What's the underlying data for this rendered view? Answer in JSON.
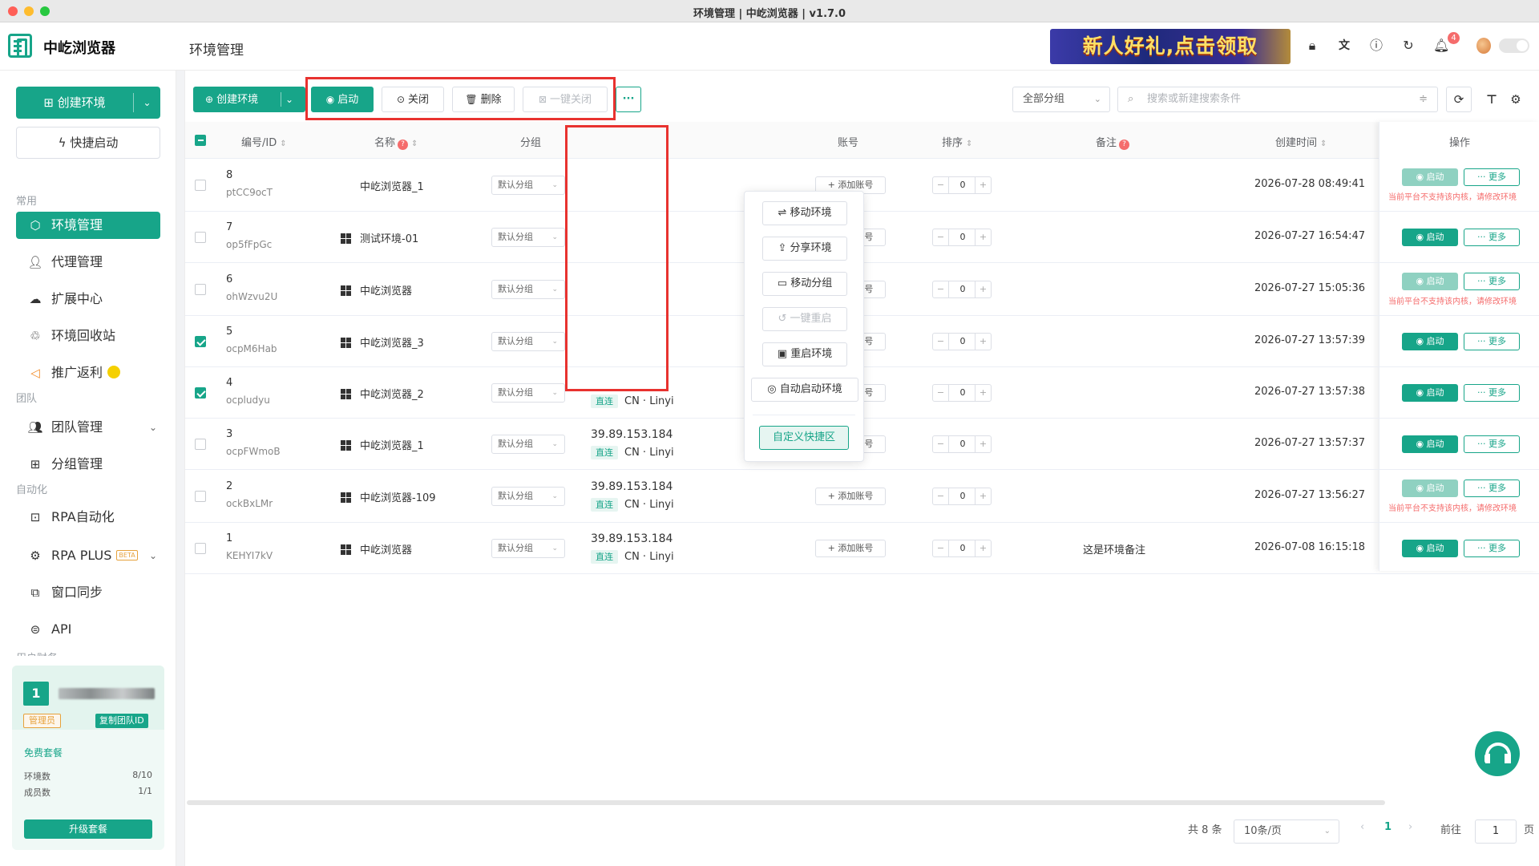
{
  "window": {
    "title": "环境管理 | 中屹浏览器 | v1.7.0"
  },
  "header": {
    "brand": "中屹浏览器",
    "page_title": "环境管理",
    "promo_text": "新人好礼,点击领取",
    "notification_count": "4"
  },
  "sidebar": {
    "create_env": "创建环境",
    "quick_start": "快捷启动",
    "section_common": "常用",
    "env_manage": "环境管理",
    "proxy_manage": "代理管理",
    "extension_center": "扩展中心",
    "env_recycle": "环境回收站",
    "promo_rebate": "推广返利",
    "section_team": "团队",
    "team_manage": "团队管理",
    "group_manage": "分组管理",
    "section_automation": "自动化",
    "rpa": "RPA自动化",
    "rpa_plus": "RPA PLUS",
    "beta": "BETA",
    "window_sync": "窗口同步",
    "api": "API",
    "section_user": "用户财务"
  },
  "team_card": {
    "number": "1",
    "role": "管理员",
    "copy_id": "复制团队ID",
    "plan": "免费套餐",
    "env_count_label": "环境数",
    "env_count_value": "8/10",
    "member_count_label": "成员数",
    "member_count_value": "1/1",
    "upgrade": "升级套餐"
  },
  "toolbar": {
    "create_env": "创建环境",
    "start": "启动",
    "close": "关闭",
    "delete": "删除",
    "close_all": "一键关闭",
    "more": "···",
    "group_filter": "全部分组",
    "search_placeholder": "搜索或新建搜索条件"
  },
  "table": {
    "headers": {
      "id": "编号/ID",
      "name": "名称",
      "group": "分组",
      "account": "账号",
      "sort": "排序",
      "note": "备注",
      "created": "创建时间",
      "ops": "操作"
    },
    "add_account": "添加账号",
    "start_label": "启动",
    "more_label": "更多",
    "warn_text": "当前平台不支持该内核，请修改环境",
    "direct_label": "直连",
    "rows": [
      {
        "id": "8",
        "code": "ptCC9ocT",
        "name": "中屹浏览器_1",
        "os": "mac",
        "group": "默认分组",
        "ip": "",
        "loc": "",
        "sort": "0",
        "note": "",
        "created": "2026-07-28 08:49:41",
        "checked": false,
        "disabled": true
      },
      {
        "id": "7",
        "code": "op5fFpGc",
        "name": "测试环境-01",
        "os": "win",
        "group": "默认分组",
        "ip": "",
        "loc": "",
        "sort": "0",
        "note": "",
        "created": "2026-07-27 16:54:47",
        "checked": false,
        "disabled": false
      },
      {
        "id": "6",
        "code": "ohWzvu2U",
        "name": "中屹浏览器",
        "os": "win",
        "group": "默认分组",
        "ip": "",
        "loc": "",
        "sort": "0",
        "note": "",
        "created": "2026-07-27 15:05:36",
        "checked": false,
        "disabled": true
      },
      {
        "id": "5",
        "code": "ocpM6Hab",
        "name": "中屹浏览器_3",
        "os": "win",
        "group": "默认分组",
        "ip": "",
        "loc": "",
        "sort": "0",
        "note": "",
        "created": "2026-07-27 13:57:39",
        "checked": true,
        "disabled": false
      },
      {
        "id": "4",
        "code": "ocpludyu",
        "name": "中屹浏览器_2",
        "os": "win",
        "group": "默认分组",
        "ip": "",
        "loc": "CN · Linyi",
        "sort": "0",
        "note": "",
        "created": "2026-07-27 13:57:38",
        "checked": true,
        "disabled": false
      },
      {
        "id": "3",
        "code": "ocpFWmoB",
        "name": "中屹浏览器_1",
        "os": "win",
        "group": "默认分组",
        "ip": "39.89.153.184",
        "loc": "CN · Linyi",
        "sort": "0",
        "note": "",
        "created": "2026-07-27 13:57:37",
        "checked": false,
        "disabled": false
      },
      {
        "id": "2",
        "code": "ockBxLMr",
        "name": "中屹浏览器-109",
        "os": "win",
        "group": "默认分组",
        "ip": "39.89.153.184",
        "loc": "CN · Linyi",
        "sort": "0",
        "note": "",
        "created": "2026-07-27 13:56:27",
        "checked": false,
        "disabled": true
      },
      {
        "id": "1",
        "code": "KEHYI7kV",
        "name": "中屹浏览器",
        "os": "win",
        "group": "默认分组",
        "ip": "39.89.153.184",
        "loc": "CN · Linyi",
        "sort": "0",
        "note": "这是环境备注",
        "created": "2026-07-08 16:15:18",
        "checked": false,
        "disabled": false
      }
    ]
  },
  "dropdown": {
    "move_env": "移动环境",
    "share_env": "分享环境",
    "move_group": "移动分组",
    "one_click_restart": "一键重启",
    "restart_env": "重启环境",
    "auto_start_env": "自动启动环境",
    "custom_shortcut": "自定义快捷区"
  },
  "pagination": {
    "total": "共 8 条",
    "page_size": "10条/页",
    "current": "1",
    "goto": "前往",
    "goto_value": "1",
    "page_unit": "页"
  },
  "colors": {
    "accent": "#17a589",
    "danger": "#f56c6c",
    "highlight_box": "#e8322f"
  }
}
